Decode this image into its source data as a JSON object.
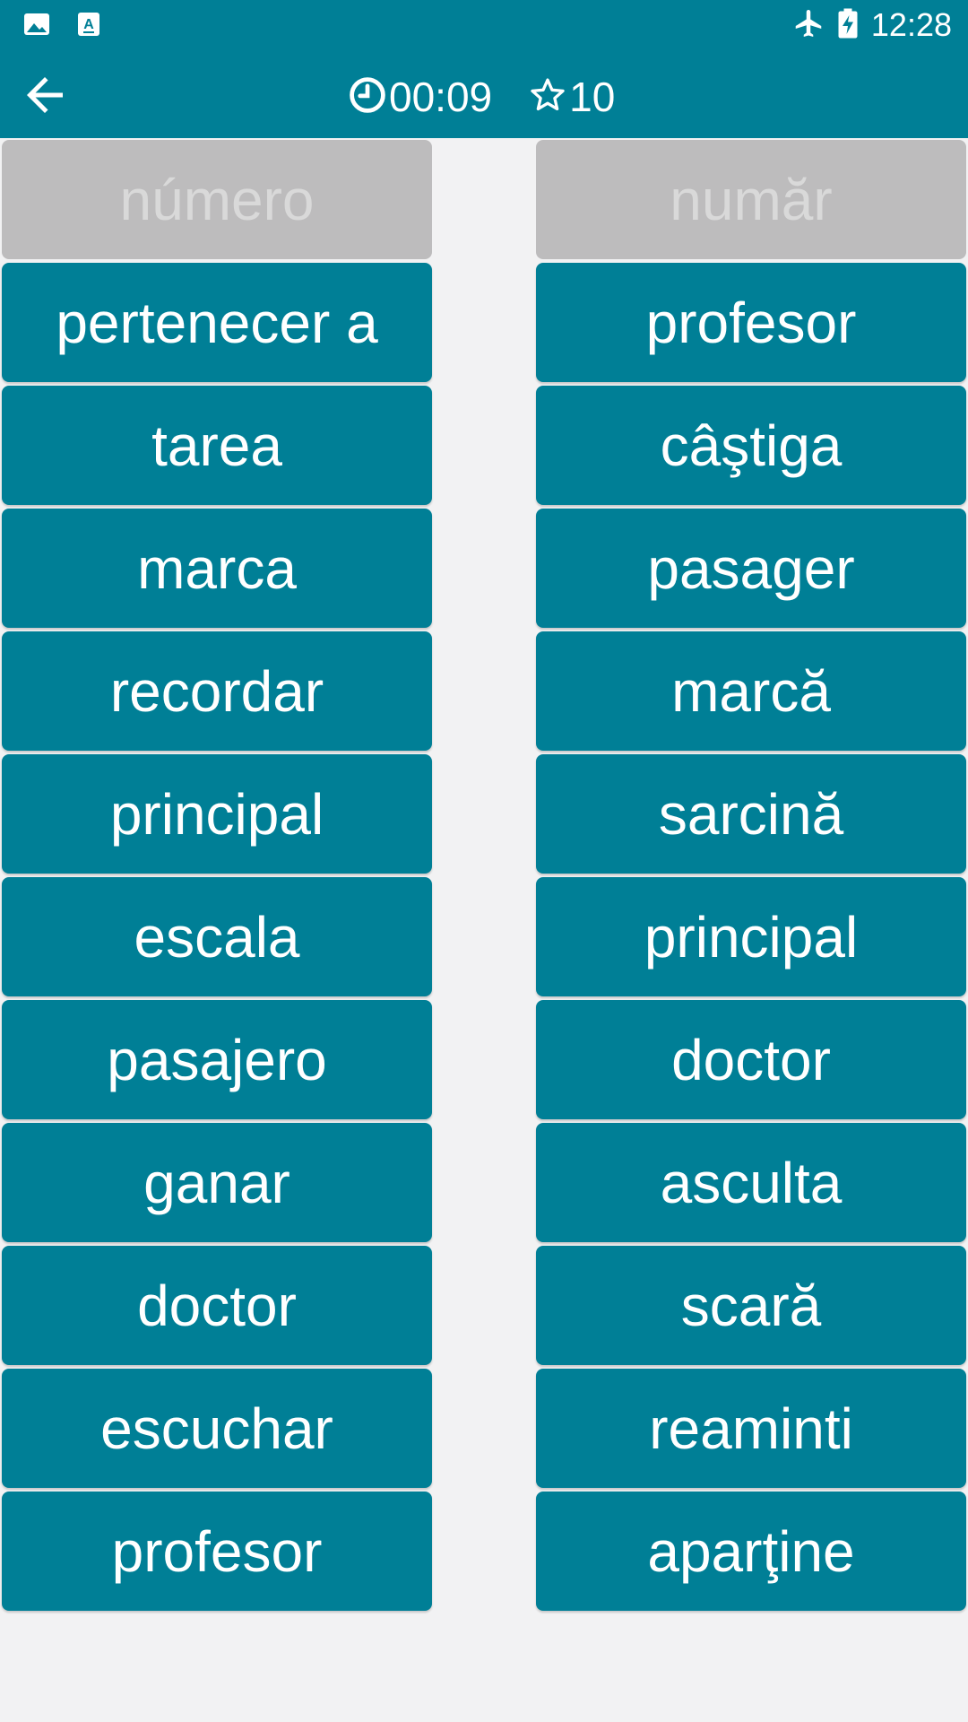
{
  "status_bar": {
    "left_icons": [
      "image-icon",
      "font-download-icon"
    ],
    "right_icons": [
      "airplane-mode-icon",
      "battery-charging-icon"
    ],
    "time": "12:28"
  },
  "header": {
    "back_icon": "arrow-back-icon",
    "timer_icon": "clock-icon",
    "timer": "00:09",
    "score_icon": "star-outline-icon",
    "score": "10"
  },
  "colors": {
    "primary": "#007f96",
    "matched_tile": "#bdbcbd",
    "matched_text": "#d9d9d9",
    "background": "#f2f2f3"
  },
  "left_words": [
    {
      "text": "número",
      "matched": true
    },
    {
      "text": "pertenecer a",
      "matched": false
    },
    {
      "text": "tarea",
      "matched": false
    },
    {
      "text": "marca",
      "matched": false
    },
    {
      "text": "recordar",
      "matched": false
    },
    {
      "text": "principal",
      "matched": false
    },
    {
      "text": "escala",
      "matched": false
    },
    {
      "text": "pasajero",
      "matched": false
    },
    {
      "text": "ganar",
      "matched": false
    },
    {
      "text": "doctor",
      "matched": false
    },
    {
      "text": "escuchar",
      "matched": false
    },
    {
      "text": "profesor",
      "matched": false
    }
  ],
  "right_words": [
    {
      "text": "număr",
      "matched": true
    },
    {
      "text": "profesor",
      "matched": false
    },
    {
      "text": "câştiga",
      "matched": false
    },
    {
      "text": "pasager",
      "matched": false
    },
    {
      "text": "marcă",
      "matched": false
    },
    {
      "text": "sarcină",
      "matched": false
    },
    {
      "text": "principal",
      "matched": false
    },
    {
      "text": "doctor",
      "matched": false
    },
    {
      "text": "asculta",
      "matched": false
    },
    {
      "text": "scară",
      "matched": false
    },
    {
      "text": "reaminti",
      "matched": false
    },
    {
      "text": "aparţine",
      "matched": false
    }
  ]
}
